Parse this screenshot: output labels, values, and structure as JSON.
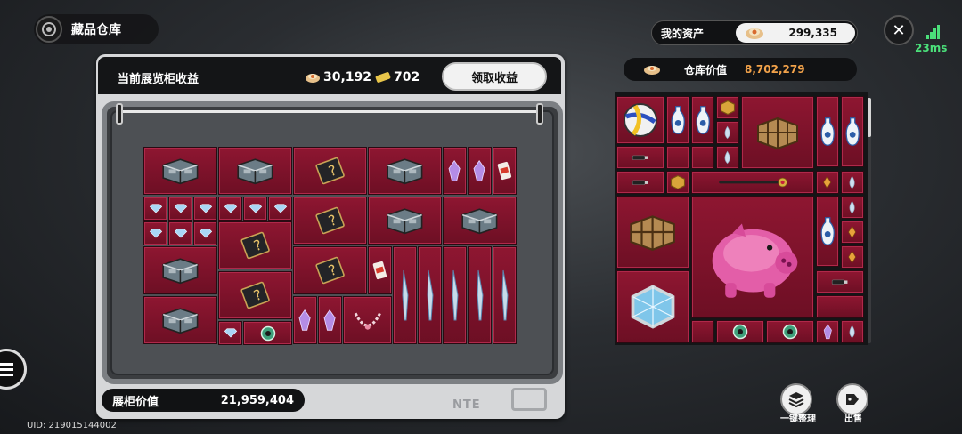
{
  "header": {
    "title": "藏品仓库"
  },
  "exhibit": {
    "income_label": "当前展览柜收益",
    "coin_amount": "30,192",
    "ticket_amount": "702",
    "claim_button": "领取收益",
    "cabinet_value_label": "展柜价值",
    "cabinet_value": "21,959,404",
    "brand": "NTE"
  },
  "assets": {
    "my_assets_label": "我的资产",
    "my_assets_value": "299,335",
    "warehouse_value_label": "仓库价值",
    "warehouse_value": "8,702,279"
  },
  "status": {
    "ping": "23ms"
  },
  "actions": {
    "organize_label": "一键整理",
    "sell_label": "出售"
  },
  "footer": {
    "uid": "UID: 219015144002"
  },
  "colors": {
    "slot": "#7d1229",
    "warehouse_value": "#f2a24a",
    "ping": "#4be07a"
  },
  "cabinet_items": [
    {
      "icon": "box-icon"
    },
    {
      "icon": "box-icon"
    },
    {
      "icon": "card-icon"
    },
    {
      "icon": "box-icon"
    },
    {
      "icon": "crystal-icon"
    },
    {
      "icon": "crystal-icon"
    },
    {
      "icon": "chip-bag-icon"
    },
    {
      "icon": "gem-icon"
    },
    {
      "icon": "card-icon"
    },
    {
      "icon": "box-icon"
    },
    {
      "icon": "box-icon"
    },
    {
      "icon": "card-icon"
    },
    {
      "icon": "box-icon"
    },
    {
      "icon": "card-icon"
    },
    {
      "icon": "chip-bag-icon"
    },
    {
      "icon": "blade-icon"
    },
    {
      "icon": "box-icon"
    },
    {
      "icon": "card-icon"
    },
    {
      "icon": "gem-icon"
    },
    {
      "icon": "jade-icon"
    },
    {
      "icon": "crystal-icon"
    },
    {
      "icon": "necklace-icon"
    }
  ],
  "warehouse_items": [
    {
      "icon": "volleyball-icon"
    },
    {
      "icon": "vase-icon"
    },
    {
      "icon": "gold-cube-icon"
    },
    {
      "icon": "shelf-icon"
    },
    {
      "icon": "usb-icon"
    },
    {
      "icon": "scepter-icon"
    },
    {
      "icon": "piggy-bank-icon"
    },
    {
      "icon": "ice-cube-icon"
    },
    {
      "icon": "jade-icon"
    }
  ]
}
